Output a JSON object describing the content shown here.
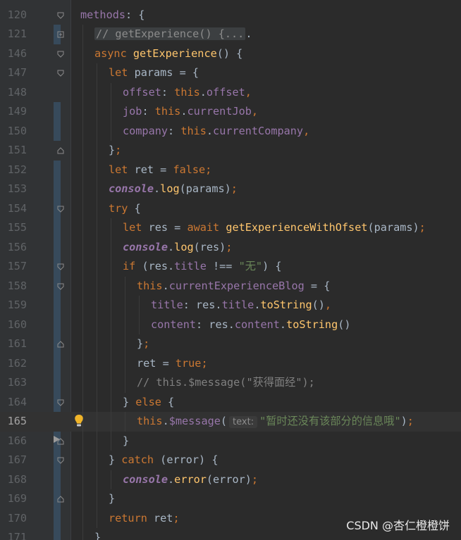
{
  "editor": {
    "lines": [
      {
        "num": "120",
        "indent": 0,
        "fold": "open",
        "tokens": [
          [
            "prop",
            "methods"
          ],
          [
            "p",
            ": {"
          ]
        ]
      },
      {
        "num": "121",
        "indent": 1,
        "fold": "collapsed",
        "tokens": [
          [
            "fold-pill",
            "// getExperience() {..."
          ],
          [
            "p",
            "."
          ]
        ]
      },
      {
        "num": "146",
        "indent": 1,
        "fold": "open",
        "tokens": [
          [
            "kw",
            "async "
          ],
          [
            "fn",
            "getExperience"
          ],
          [
            "p",
            "() {"
          ]
        ]
      },
      {
        "num": "147",
        "indent": 2,
        "fold": "open",
        "tokens": [
          [
            "kw",
            "let "
          ],
          [
            "p",
            "params = {"
          ]
        ]
      },
      {
        "num": "148",
        "indent": 3,
        "fold": "",
        "tokens": [
          [
            "prop",
            "offset"
          ],
          [
            "p",
            ": "
          ],
          [
            "kw",
            "this"
          ],
          [
            "p",
            "."
          ],
          [
            "prop",
            "offset"
          ],
          [
            "kw",
            ","
          ]
        ]
      },
      {
        "num": "149",
        "indent": 3,
        "fold": "",
        "tokens": [
          [
            "prop",
            "job"
          ],
          [
            "p",
            ": "
          ],
          [
            "kw",
            "this"
          ],
          [
            "p",
            "."
          ],
          [
            "prop",
            "currentJob"
          ],
          [
            "kw",
            ","
          ]
        ]
      },
      {
        "num": "150",
        "indent": 3,
        "fold": "",
        "tokens": [
          [
            "prop",
            "company"
          ],
          [
            "p",
            ": "
          ],
          [
            "kw",
            "this"
          ],
          [
            "p",
            "."
          ],
          [
            "prop",
            "currentCompany"
          ],
          [
            "kw",
            ","
          ]
        ]
      },
      {
        "num": "151",
        "indent": 2,
        "fold": "close",
        "tokens": [
          [
            "p",
            "}"
          ],
          [
            "kw",
            ";"
          ]
        ]
      },
      {
        "num": "152",
        "indent": 2,
        "fold": "",
        "tokens": [
          [
            "kw",
            "let "
          ],
          [
            "p",
            "ret = "
          ],
          [
            "kw",
            "false;"
          ]
        ]
      },
      {
        "num": "153",
        "indent": 2,
        "fold": "",
        "tokens": [
          [
            "con",
            "console"
          ],
          [
            "p",
            "."
          ],
          [
            "fn",
            "log"
          ],
          [
            "p",
            "(params)"
          ],
          [
            "kw",
            ";"
          ]
        ]
      },
      {
        "num": "154",
        "indent": 2,
        "fold": "open",
        "tokens": [
          [
            "kw",
            "try "
          ],
          [
            "p",
            "{"
          ]
        ]
      },
      {
        "num": "155",
        "indent": 3,
        "fold": "",
        "tokens": [
          [
            "kw",
            "let "
          ],
          [
            "p",
            "res = "
          ],
          [
            "kw",
            "await "
          ],
          [
            "fn",
            "getExperienceWithOfset"
          ],
          [
            "p",
            "(params)"
          ],
          [
            "kw",
            ";"
          ]
        ]
      },
      {
        "num": "156",
        "indent": 3,
        "fold": "",
        "tokens": [
          [
            "con",
            "console"
          ],
          [
            "p",
            "."
          ],
          [
            "fn",
            "log"
          ],
          [
            "p",
            "(res)"
          ],
          [
            "kw",
            ";"
          ]
        ]
      },
      {
        "num": "157",
        "indent": 3,
        "fold": "open",
        "tokens": [
          [
            "kw",
            "if "
          ],
          [
            "p",
            "(res."
          ],
          [
            "prop",
            "title"
          ],
          [
            "p",
            " !== "
          ],
          [
            "str",
            "\"无\""
          ],
          [
            "p",
            ") {"
          ]
        ]
      },
      {
        "num": "158",
        "indent": 4,
        "fold": "open",
        "tokens": [
          [
            "kw",
            "this"
          ],
          [
            "p",
            "."
          ],
          [
            "prop",
            "currentExperienceBlog"
          ],
          [
            "p",
            " = {"
          ]
        ]
      },
      {
        "num": "159",
        "indent": 5,
        "fold": "",
        "tokens": [
          [
            "prop",
            "title"
          ],
          [
            "p",
            ": res."
          ],
          [
            "prop",
            "title"
          ],
          [
            "p",
            "."
          ],
          [
            "fn",
            "toString"
          ],
          [
            "p",
            "()"
          ],
          [
            "kw",
            ","
          ]
        ]
      },
      {
        "num": "160",
        "indent": 5,
        "fold": "",
        "tokens": [
          [
            "prop",
            "content"
          ],
          [
            "p",
            ": res."
          ],
          [
            "prop",
            "content"
          ],
          [
            "p",
            "."
          ],
          [
            "fn",
            "toString"
          ],
          [
            "p",
            "()"
          ]
        ]
      },
      {
        "num": "161",
        "indent": 4,
        "fold": "close",
        "tokens": [
          [
            "p",
            "}"
          ],
          [
            "kw",
            ";"
          ]
        ]
      },
      {
        "num": "162",
        "indent": 4,
        "fold": "",
        "tokens": [
          [
            "p",
            "ret = "
          ],
          [
            "kw",
            "true;"
          ]
        ]
      },
      {
        "num": "163",
        "indent": 4,
        "fold": "",
        "tokens": [
          [
            "cm",
            "// this.$message(\"获得面经\");"
          ]
        ]
      },
      {
        "num": "164",
        "indent": 3,
        "fold": "open",
        "tokens": [
          [
            "p",
            "} "
          ],
          [
            "kw",
            "else "
          ],
          [
            "p",
            "{"
          ]
        ]
      },
      {
        "num": "165",
        "indent": 4,
        "fold": "",
        "current": true,
        "tokens": [
          [
            "kw",
            "this"
          ],
          [
            "p",
            "."
          ],
          [
            "prop",
            "$message"
          ],
          [
            "p",
            "("
          ],
          [
            "hint",
            "text:"
          ],
          [
            "str",
            "\"暂时还没有该部分的信息哦\""
          ],
          [
            "p",
            ")"
          ],
          [
            "kw",
            ";"
          ]
        ]
      },
      {
        "num": "166",
        "indent": 3,
        "fold": "close",
        "tokens": [
          [
            "p",
            "}"
          ]
        ]
      },
      {
        "num": "167",
        "indent": 2,
        "fold": "open",
        "tokens": [
          [
            "p",
            "} "
          ],
          [
            "kw",
            "catch "
          ],
          [
            "p",
            "(error) {"
          ]
        ]
      },
      {
        "num": "168",
        "indent": 3,
        "fold": "",
        "tokens": [
          [
            "con",
            "console"
          ],
          [
            "p",
            "."
          ],
          [
            "fn",
            "error"
          ],
          [
            "p",
            "(error)"
          ],
          [
            "kw",
            ";"
          ]
        ]
      },
      {
        "num": "169",
        "indent": 2,
        "fold": "close",
        "tokens": [
          [
            "p",
            "}"
          ]
        ]
      },
      {
        "num": "170",
        "indent": 2,
        "fold": "",
        "tokens": [
          [
            "kw",
            "return "
          ],
          [
            "p",
            "ret"
          ],
          [
            "kw",
            ";"
          ]
        ]
      },
      {
        "num": "171",
        "indent": 1,
        "fold": "",
        "tokens": [
          [
            "p",
            "}"
          ]
        ]
      }
    ]
  },
  "icons": {
    "fold_open": "fold-open-icon",
    "fold_close": "fold-close-icon",
    "fold_collapsed": "fold-expand-icon",
    "bulb": "lightbulb-icon"
  },
  "colors": {
    "background": "#2b2b2b",
    "keyword": "#cc7832",
    "property": "#9876aa",
    "function": "#ffc66d",
    "string": "#6a8759",
    "comment": "#808080",
    "text": "#a9b7c6"
  },
  "watermark": "CSDN @杏仁橙橙饼"
}
